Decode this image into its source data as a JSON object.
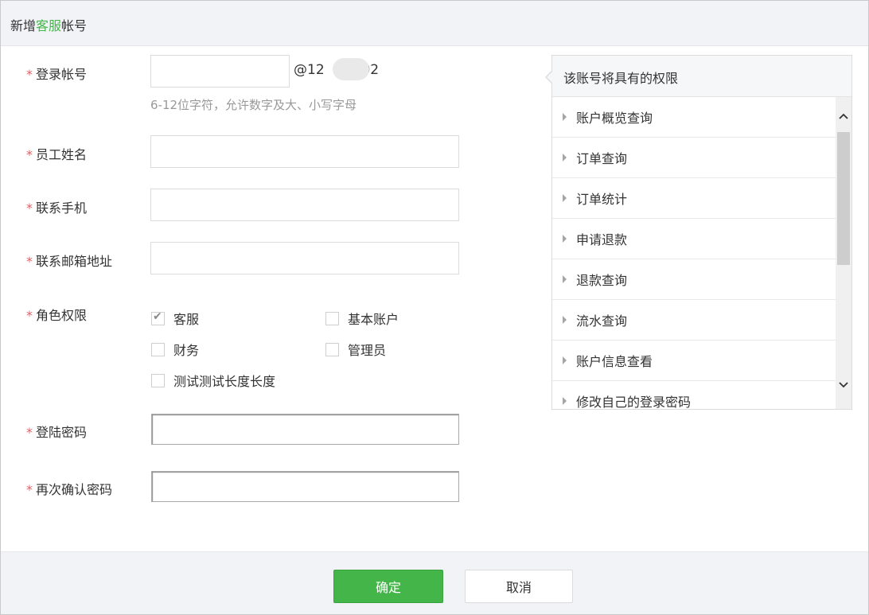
{
  "dialog": {
    "title_prefix": "新增",
    "title_highlight": "客服",
    "title_suffix": "帐号"
  },
  "colors": {
    "accent": "#44b549",
    "required": "#e15f63",
    "hint": "#999999"
  },
  "form": {
    "required_mark": "*",
    "account": {
      "label": "登录帐号",
      "value": "",
      "suffix_left": "@12",
      "suffix_right": "302",
      "hint": "6-12位字符，允许数字及大、小写字母"
    },
    "name": {
      "label": "员工姓名",
      "value": ""
    },
    "phone": {
      "label": "联系手机",
      "value": ""
    },
    "email": {
      "label": "联系邮箱地址",
      "value": ""
    },
    "roles": {
      "label": "角色权限",
      "options": [
        {
          "label": "客服",
          "checked": true
        },
        {
          "label": "基本账户",
          "checked": false
        },
        {
          "label": "财务",
          "checked": false
        },
        {
          "label": "管理员",
          "checked": false
        },
        {
          "label": "测试测试长度长度",
          "checked": false
        }
      ]
    },
    "password": {
      "label": "登陆密码",
      "value": ""
    },
    "confirm_password": {
      "label": "再次确认密码",
      "value": ""
    }
  },
  "permissions": {
    "title": "该账号将具有的权限",
    "items": [
      "账户概览查询",
      "订单查询",
      "订单统计",
      "申请退款",
      "退款查询",
      "流水查询",
      "账户信息查看",
      "修改自己的登录密码"
    ],
    "icons": {
      "item": "caret-right-icon",
      "scroll_up": "chevron-up-icon",
      "scroll_down": "chevron-down-icon"
    }
  },
  "footer": {
    "ok_label": "确定",
    "cancel_label": "取消"
  }
}
